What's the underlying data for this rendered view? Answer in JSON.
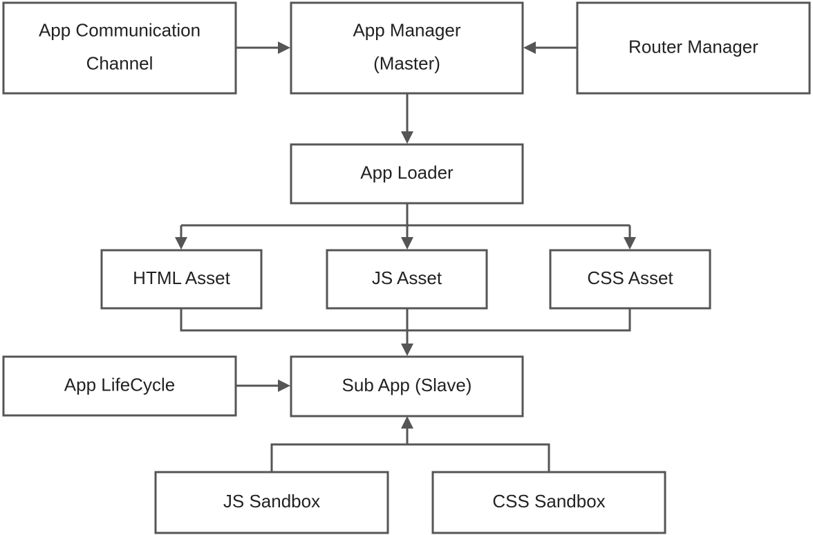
{
  "nodes": {
    "comm": {
      "lines": [
        "App Communication",
        "Channel"
      ]
    },
    "manager": {
      "lines": [
        "App Manager",
        "(Master)"
      ]
    },
    "router": {
      "lines": [
        "Router Manager"
      ]
    },
    "loader": {
      "lines": [
        "App Loader"
      ]
    },
    "html": {
      "lines": [
        "HTML Asset"
      ]
    },
    "js": {
      "lines": [
        "JS Asset"
      ]
    },
    "css": {
      "lines": [
        "CSS Asset"
      ]
    },
    "lifecycle": {
      "lines": [
        "App LifeCycle"
      ]
    },
    "subapp": {
      "lines": [
        "Sub App (Slave)"
      ]
    },
    "jssandbox": {
      "lines": [
        "JS Sandbox"
      ]
    },
    "csssandbox": {
      "lines": [
        "CSS Sandbox"
      ]
    }
  },
  "colors": {
    "stroke": "#555555",
    "text": "#222222"
  }
}
